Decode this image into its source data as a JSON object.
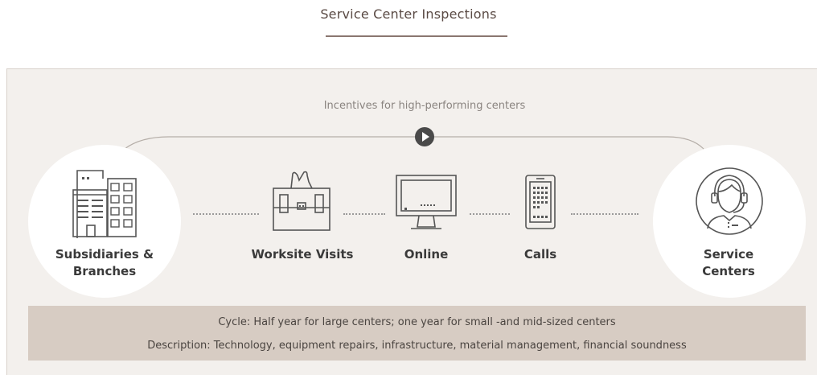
{
  "title": "Service Center Inspections",
  "incentive_label": "Incentives for high-performing centers",
  "nodes": {
    "subsidiaries": {
      "line1": "Subsidiaries &",
      "line2": "Branches",
      "icon": "buildings-icon"
    },
    "worksite": {
      "label": "Worksite Visits",
      "icon": "briefcase-icon"
    },
    "online": {
      "label": "Online",
      "icon": "monitor-icon"
    },
    "calls": {
      "label": "Calls",
      "icon": "phone-icon"
    },
    "service": {
      "line1": "Service",
      "line2": "Centers",
      "icon": "headset-agent-icon"
    }
  },
  "footer": {
    "cycle": "Cycle: Half year for large centers; one year for small -and mid-sized centers",
    "description": "Description: Technology, equipment repairs, infrastructure, material management, financial soundness"
  },
  "colors": {
    "panel_bg": "#f3f0ed",
    "footer_bg": "#d7ccc3",
    "title_underline": "#8a7670",
    "icon_stroke": "#555555"
  }
}
